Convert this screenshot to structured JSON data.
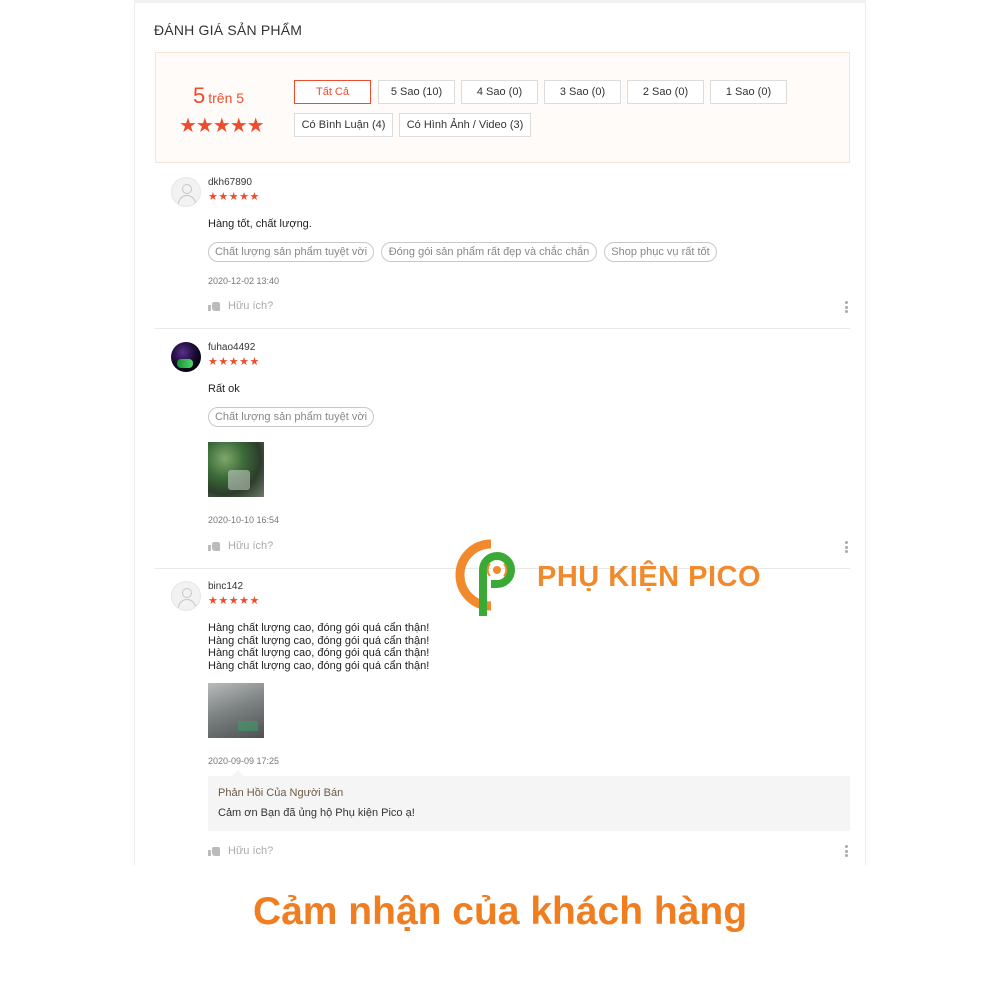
{
  "section_title": "ĐÁNH GIÁ SẢN PHẨM",
  "overview": {
    "score": "5",
    "score_suffix": "trên 5",
    "stars": "★★★★★",
    "star_value": 5
  },
  "filters": [
    {
      "label": "Tất Cả",
      "active": true
    },
    {
      "label": "5 Sao (10)",
      "active": false
    },
    {
      "label": "4 Sao (0)",
      "active": false
    },
    {
      "label": "3 Sao (0)",
      "active": false
    },
    {
      "label": "2 Sao (0)",
      "active": false
    },
    {
      "label": "1 Sao (0)",
      "active": false
    },
    {
      "label": "Có Bình Luận (4)",
      "active": false
    },
    {
      "label": "Có Hình Ảnh / Video (3)",
      "active": false
    }
  ],
  "reviews": [
    {
      "user": "dkh67890",
      "stars": "★★★★★",
      "rating": 5,
      "comment_lines": [
        "Hàng tốt, chất lượng."
      ],
      "tags": [
        "Chất lượng sản phẩm tuyệt vời",
        "Đóng gói sản phẩm rất đẹp và chắc chắn",
        "Shop phục vụ rất tốt"
      ],
      "time": "2020-12-02 13:40",
      "helpful": "Hữu ích?"
    },
    {
      "user": "fuhao4492",
      "stars": "★★★★★",
      "rating": 5,
      "comment_lines": [
        "Rất ok"
      ],
      "tags": [
        "Chất lượng sản phẩm tuyệt vời"
      ],
      "time": "2020-10-10 16:54",
      "helpful": "Hữu ích?"
    },
    {
      "user": "binc142",
      "stars": "★★★★★",
      "rating": 5,
      "comment_lines": [
        "Hàng chất lượng cao, đóng gói quá cẩn thận!",
        "Hàng chất lượng cao, đóng gói quá cẩn thận!",
        "Hàng chất lượng cao, đóng gói quá cẩn thận!",
        "Hàng chất lượng cao, đóng gói quá cẩn thận!"
      ],
      "time": "2020-09-09 17:25",
      "seller_reply": {
        "title": "Phản Hồi Của Người Bán",
        "body": "Cảm ơn Bạn đã ủng hộ Phụ kiện Pico ạ!"
      },
      "helpful": "Hữu ích?"
    }
  ],
  "brand": {
    "name": "PHỤ KIỆN PICO",
    "logo_orange": "#f08a2c",
    "logo_green": "#3aa935"
  },
  "caption": "Cảm nhận của khách hàng",
  "colors": {
    "accent": "#ee4d2d",
    "caption": "#f07d1f"
  }
}
